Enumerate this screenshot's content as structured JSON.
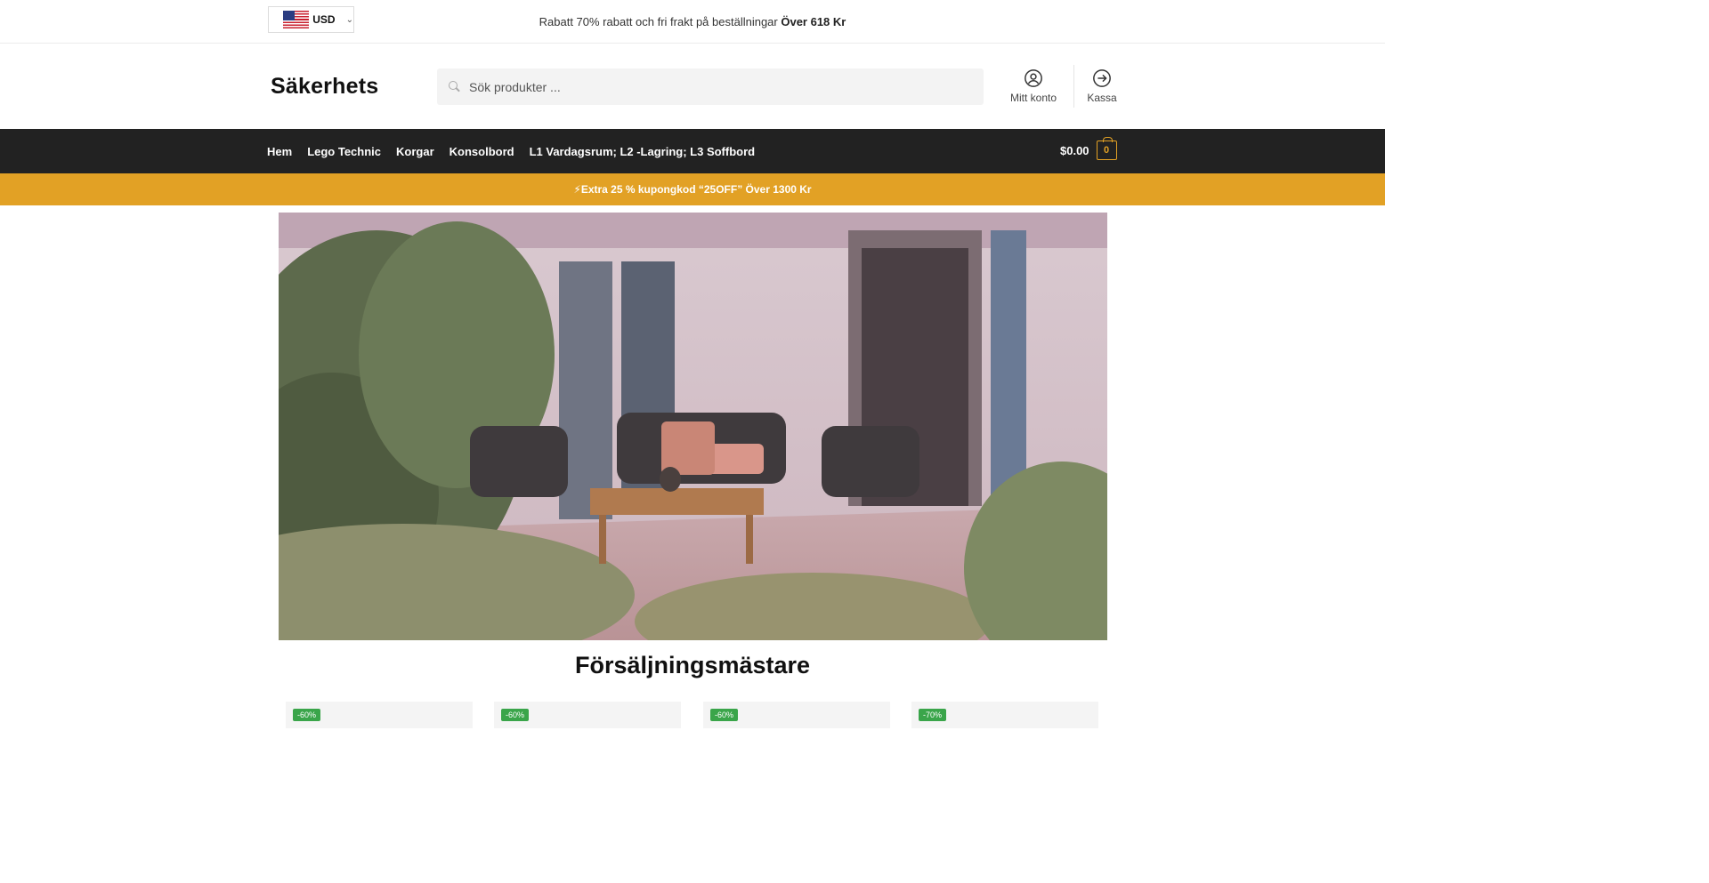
{
  "topbar": {
    "currency_code": "USD",
    "promo_text": "Rabatt 70% rabatt och fri frakt på beställningar ",
    "promo_bold": "Över 618 Kr"
  },
  "header": {
    "logo": "Säkerhets",
    "search_placeholder": "Sök produkter ...",
    "account_label": "Mitt konto",
    "checkout_label": "Kassa"
  },
  "nav": {
    "items": [
      {
        "label": "Hem"
      },
      {
        "label": "Lego Technic"
      },
      {
        "label": "Korgar"
      },
      {
        "label": "Konsolbord"
      },
      {
        "label": "L1 Vardagsrum; L2 -Lagring; L3 Soffbord"
      }
    ],
    "cart_amount": "$0.00",
    "cart_count": "0"
  },
  "coupon": {
    "icon": "lightning-icon",
    "text": "⚡Extra 25 % kupongkod “25OFF” Över 1300 Kr"
  },
  "hero": {
    "alt_icon": "hero-patio-image"
  },
  "section": {
    "title": "Försäljningsmästare"
  },
  "products": [
    {
      "badge": "-60%"
    },
    {
      "badge": "-60%"
    },
    {
      "badge": "-60%"
    },
    {
      "badge": "-70%"
    }
  ],
  "colors": {
    "nav_bg": "#222222",
    "accent": "#e2a125",
    "badge": "#3aa54a"
  }
}
